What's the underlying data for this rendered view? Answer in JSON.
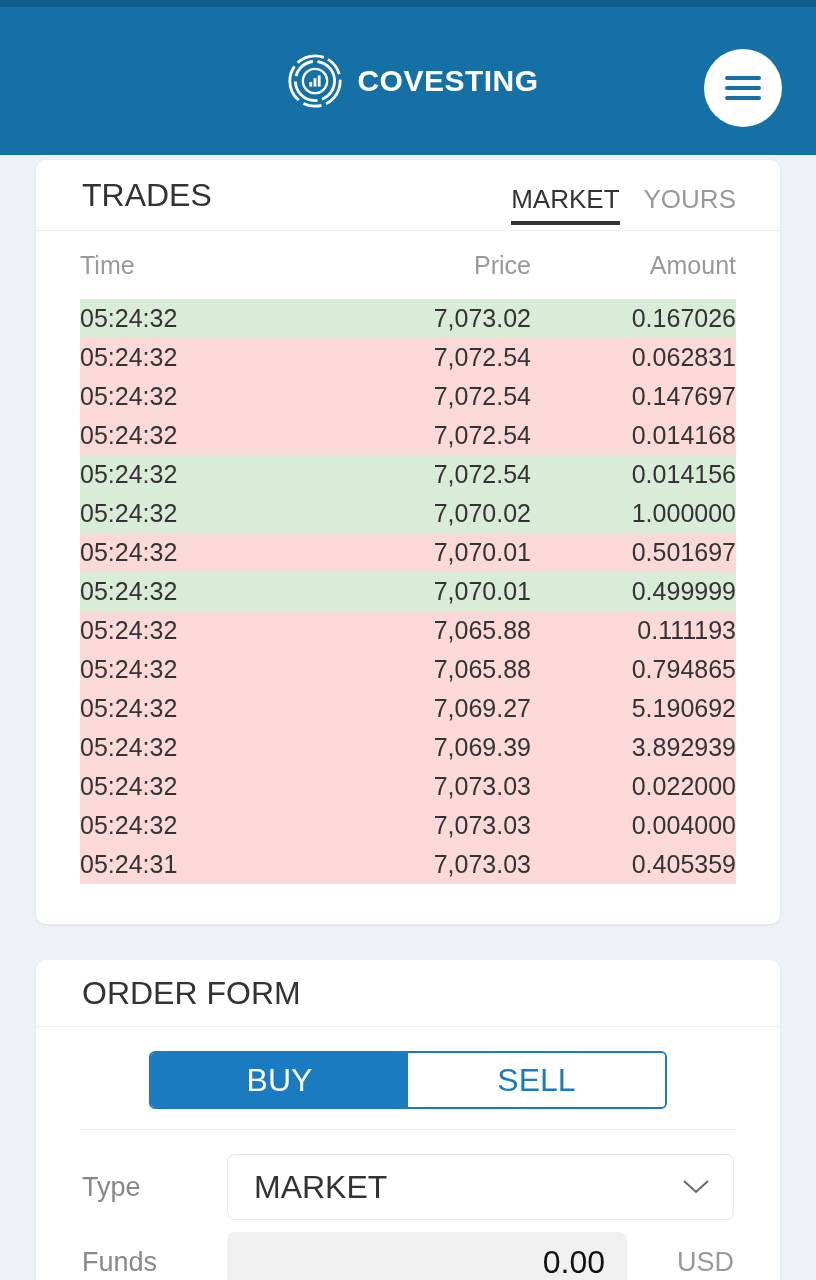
{
  "header": {
    "brand": "COVESTING"
  },
  "trades": {
    "title": "TRADES",
    "tabs": [
      {
        "label": "MARKET",
        "selected": true
      },
      {
        "label": "YOURS",
        "selected": false
      }
    ],
    "columns": [
      "Time",
      "Price",
      "Amount"
    ],
    "rows": [
      {
        "time": "05:24:32",
        "price": "7,073.02",
        "amount": "0.167026",
        "kind": "buy"
      },
      {
        "time": "05:24:32",
        "price": "7,072.54",
        "amount": "0.062831",
        "kind": "sell"
      },
      {
        "time": "05:24:32",
        "price": "7,072.54",
        "amount": "0.147697",
        "kind": "sell"
      },
      {
        "time": "05:24:32",
        "price": "7,072.54",
        "amount": "0.014168",
        "kind": "sell"
      },
      {
        "time": "05:24:32",
        "price": "7,072.54",
        "amount": "0.014156",
        "kind": "buy"
      },
      {
        "time": "05:24:32",
        "price": "7,070.02",
        "amount": "1.000000",
        "kind": "buy"
      },
      {
        "time": "05:24:32",
        "price": "7,070.01",
        "amount": "0.501697",
        "kind": "sell"
      },
      {
        "time": "05:24:32",
        "price": "7,070.01",
        "amount": "0.499999",
        "kind": "buy"
      },
      {
        "time": "05:24:32",
        "price": "7,065.88",
        "amount": "0.111193",
        "kind": "sell"
      },
      {
        "time": "05:24:32",
        "price": "7,065.88",
        "amount": "0.794865",
        "kind": "sell"
      },
      {
        "time": "05:24:32",
        "price": "7,069.27",
        "amount": "5.190692",
        "kind": "sell"
      },
      {
        "time": "05:24:32",
        "price": "7,069.39",
        "amount": "3.892939",
        "kind": "sell"
      },
      {
        "time": "05:24:32",
        "price": "7,073.03",
        "amount": "0.022000",
        "kind": "sell"
      },
      {
        "time": "05:24:32",
        "price": "7,073.03",
        "amount": "0.004000",
        "kind": "sell"
      },
      {
        "time": "05:24:31",
        "price": "7,073.03",
        "amount": "0.405359",
        "kind": "sell"
      }
    ]
  },
  "order_form": {
    "title": "ORDER FORM",
    "sides": [
      {
        "label": "BUY",
        "selected": true
      },
      {
        "label": "SELL",
        "selected": false
      }
    ],
    "type": {
      "label": "Type",
      "value": "MARKET"
    },
    "funds": {
      "label": "Funds",
      "value": "0.00",
      "unit": "USD"
    }
  }
}
